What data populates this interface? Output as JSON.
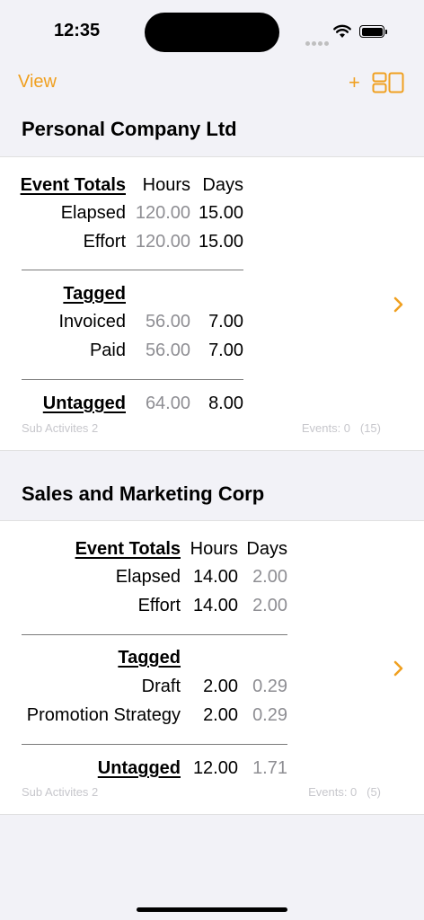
{
  "status": {
    "time": "12:35"
  },
  "nav": {
    "view_label": "View",
    "add_label": "+"
  },
  "companies": [
    {
      "name": "Personal Company Ltd",
      "event_totals_label": "Event Totals",
      "hours_header": "Hours",
      "days_header": "Days",
      "elapsed": {
        "label": "Elapsed",
        "hours": "120.00",
        "days": "15.00"
      },
      "effort": {
        "label": "Effort",
        "hours": "120.00",
        "days": "15.00"
      },
      "tagged_label": "Tagged",
      "tags": [
        {
          "label": "Invoiced",
          "hours": "56.00",
          "days": "7.00"
        },
        {
          "label": "Paid",
          "hours": "56.00",
          "days": "7.00"
        }
      ],
      "untagged": {
        "label": "Untagged",
        "hours": "64.00",
        "days": "8.00"
      },
      "sub_activities": "Sub Activites 2",
      "events": "Events: 0   (15)"
    },
    {
      "name": "Sales and Marketing Corp",
      "event_totals_label": "Event Totals",
      "hours_header": "Hours",
      "days_header": "Days",
      "elapsed": {
        "label": "Elapsed",
        "hours": "14.00",
        "days": "2.00"
      },
      "effort": {
        "label": "Effort",
        "hours": "14.00",
        "days": "2.00"
      },
      "tagged_label": "Tagged",
      "tags": [
        {
          "label": "Draft",
          "hours": "2.00",
          "days": "0.29"
        },
        {
          "label": "Promotion Strategy",
          "hours": "2.00",
          "days": "0.29"
        }
      ],
      "untagged": {
        "label": "Untagged",
        "hours": "12.00",
        "days": "1.71"
      },
      "sub_activities": "Sub Activites 2",
      "events": "Events: 0   (5)"
    }
  ],
  "colors": {
    "accent": "#f0a020",
    "secondary_text": "#8e8e93"
  }
}
